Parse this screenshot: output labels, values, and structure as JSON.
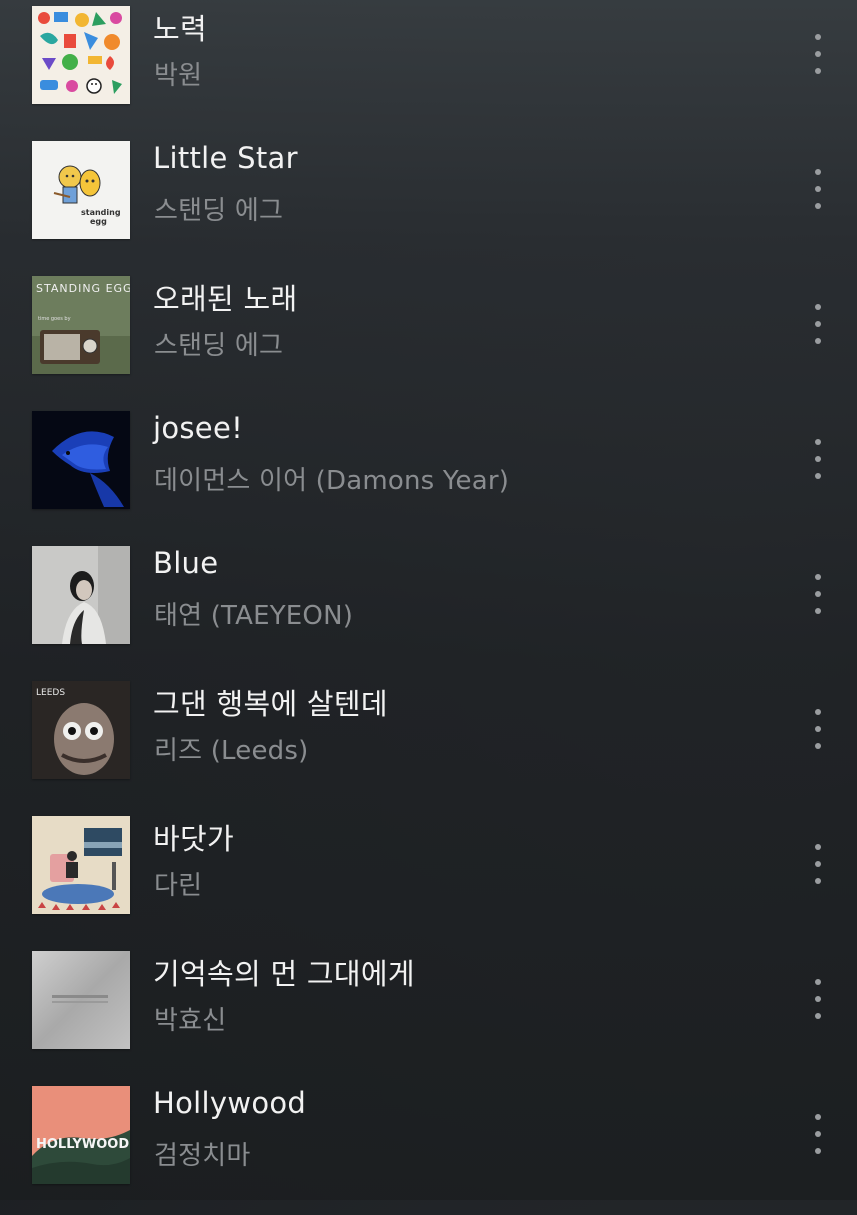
{
  "tracks": [
    {
      "title": "노력",
      "artist": "박원",
      "cover": "album-art-colorful-doodles"
    },
    {
      "title": "Little Star",
      "artist": "스탠딩 에그",
      "cover": "album-art-standing-egg-cartoon"
    },
    {
      "title": "오래된 노래",
      "artist": "스탠딩 에그",
      "cover": "album-art-standing-egg-radio",
      "cover_text": "STANDING EGG",
      "cover_subtext": "time goes by"
    },
    {
      "title": "josee!",
      "artist": "데이먼스 이어 (Damons Year)",
      "cover": "album-art-blue-fish"
    },
    {
      "title": "Blue",
      "artist": "태연 (TAEYEON)",
      "cover": "album-art-taeyeon-portrait"
    },
    {
      "title": "그댄 행복에 살텐데",
      "artist": "리즈 (Leeds)",
      "cover": "album-art-leeds-face",
      "cover_text": "LEEDS"
    },
    {
      "title": "바닷가",
      "artist": "다린",
      "cover": "album-art-darin-illustration"
    },
    {
      "title": "기억속의 먼 그대에게",
      "artist": "박효신",
      "cover": "album-art-brushed-metal"
    },
    {
      "title": "Hollywood",
      "artist": "검정치마",
      "cover": "album-art-hollywood-sign",
      "cover_text": "HOLLYWOOD"
    }
  ],
  "colors": {
    "title": "#f2f2f2",
    "artist": "#8a8d90",
    "more_dots": "#9a9da0"
  }
}
